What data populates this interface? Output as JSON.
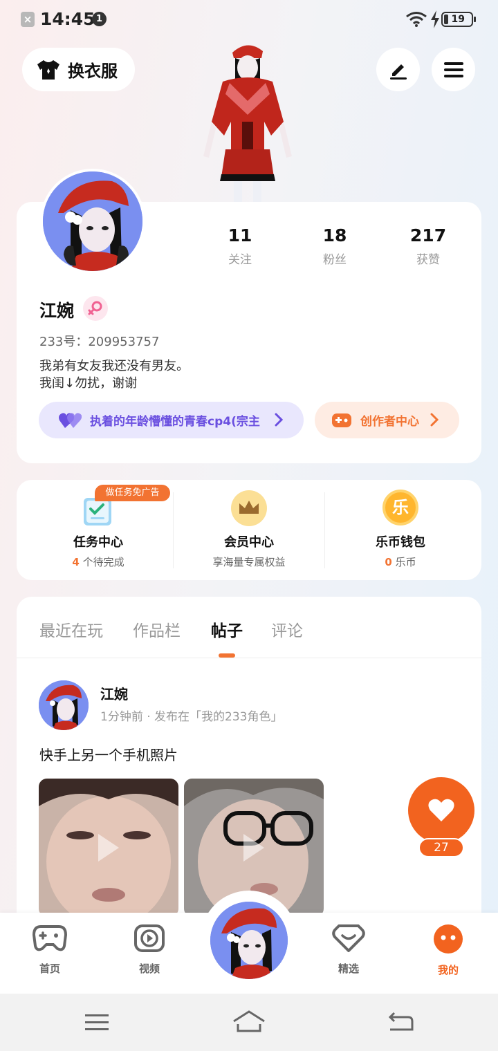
{
  "status_bar": {
    "time": "14:45",
    "notification_count": "1",
    "battery": "19"
  },
  "header": {
    "dress_button": "换衣服",
    "edit_icon": "edit-icon",
    "menu_icon": "menu-icon"
  },
  "profile": {
    "stats": [
      {
        "value": "11",
        "label": "关注"
      },
      {
        "value": "18",
        "label": "粉丝"
      },
      {
        "value": "217",
        "label": "获赞"
      }
    ],
    "name": "江婉",
    "gender": "female",
    "uid": "233号：209953757",
    "bio_line1": "我弟有女友我还没有男友。",
    "bio_line2": "我闺↓勿扰，谢谢",
    "friend_pill": "执着的年龄懵懂的青春cp4(宗主",
    "creator_pill": "创作者中心"
  },
  "quick": {
    "ad_badge": "做任务免广告",
    "items": [
      {
        "title": "任务中心",
        "count": "4",
        "sub": " 个待完成"
      },
      {
        "title": "会员中心",
        "sub": "享海量专属权益"
      },
      {
        "title": "乐币钱包",
        "count": "0",
        "sub": " 乐币",
        "icon_text": "乐"
      }
    ]
  },
  "tabs": [
    {
      "label": "最近在玩"
    },
    {
      "label": "作品栏"
    },
    {
      "label": "帖子",
      "active": true
    },
    {
      "label": "评论"
    }
  ],
  "post": {
    "author": "江婉",
    "meta": "1分钟前 · 发布在「我的233角色」",
    "text": "快手上另一个手机照片",
    "likes": "27"
  },
  "bottom_nav": [
    {
      "label": "首页"
    },
    {
      "label": "视频"
    },
    {
      "label": "精选"
    },
    {
      "label": "我的",
      "active": true
    }
  ],
  "colors": {
    "accent": "#f2631f",
    "purple": "#6a4fe0",
    "creator": "#f27332"
  }
}
